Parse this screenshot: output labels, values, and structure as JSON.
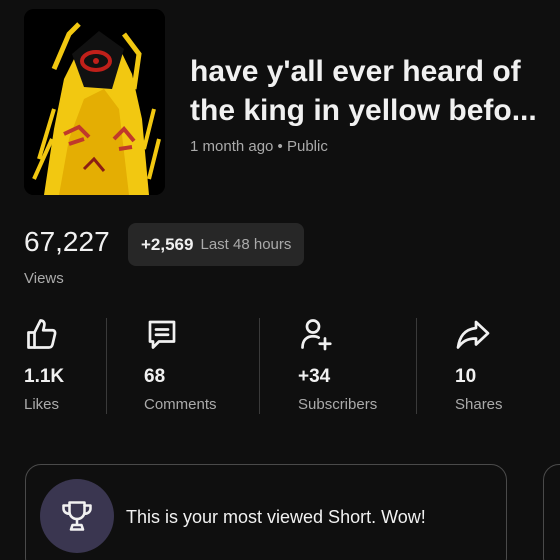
{
  "video": {
    "title_line1": "have y'all ever heard of",
    "title_line2": "the king in yellow befo...",
    "meta": "1 month ago • Public"
  },
  "views": {
    "count": "67,227",
    "delta": "+2,569",
    "delta_period": "Last 48 hours",
    "label": "Views"
  },
  "stats": [
    {
      "icon": "thumbs-up-icon",
      "value": "1.1K",
      "label": "Likes"
    },
    {
      "icon": "comment-icon",
      "value": "68",
      "label": "Comments"
    },
    {
      "icon": "add-person-icon",
      "value": "+34",
      "label": "Subscribers"
    },
    {
      "icon": "share-icon",
      "value": "10",
      "label": "Shares"
    }
  ],
  "achievement": {
    "icon": "trophy-icon",
    "text": "This is your most viewed Short. Wow!"
  },
  "colors": {
    "background": "#0f0f0f",
    "text_primary": "#f1f1f1",
    "text_secondary": "#aaaaaa",
    "pill_bg": "#272727",
    "trophy_bg": "#3a3650",
    "thumbnail_yellow": "#f2c811"
  }
}
